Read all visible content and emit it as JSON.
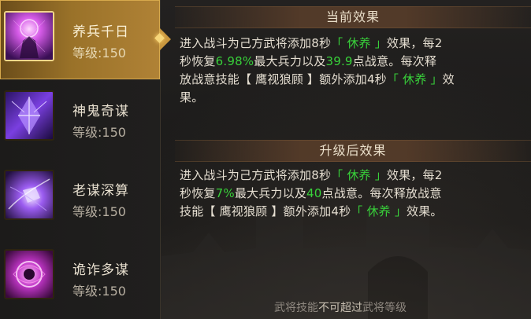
{
  "skills": [
    {
      "name": "养兵千日",
      "level_prefix": "等级:",
      "level": "150",
      "selected": true
    },
    {
      "name": "神鬼奇谋",
      "level_prefix": "等级:",
      "level": "150",
      "selected": false
    },
    {
      "name": "老谋深算",
      "level_prefix": "等级:",
      "level": "150",
      "selected": false
    },
    {
      "name": "诡诈多谋",
      "level_prefix": "等级:",
      "level": "150",
      "selected": false
    }
  ],
  "current_effect": {
    "title": "当前效果",
    "line1": {
      "a": "进入战斗为己方武将添加8秒",
      "b": "「 休养 」",
      "c": "效果，每2"
    },
    "line2": {
      "a": "秒恢复",
      "b": "6.98%",
      "c": "最大兵力以及",
      "d": "39.9",
      "e": "点战意。每次释"
    },
    "line3": {
      "a": "放战意技能【 鹰视狼顾 】额外添加4秒",
      "b": "「 休养 」",
      "c": "效"
    },
    "line4": "果。"
  },
  "upgrade_effect": {
    "title": "升级后效果",
    "line1": {
      "a": "进入战斗为己方武将添加8秒",
      "b": "「 休养 」",
      "c": "效果，每2"
    },
    "line2": {
      "a": "秒恢复",
      "b": "7%",
      "c": "最大兵力以及",
      "d": "40",
      "e": "点战意。每次释放战意"
    },
    "line3": {
      "a": "技能【 鹰视狼顾 】额外添加4秒",
      "b": "「 休养 」",
      "c": "效果。"
    }
  },
  "footer": {
    "a": "武将技能",
    "b": "不可超过",
    "c": "武将等级"
  },
  "colors": {
    "highlight": "#38d13a",
    "selected_bg": "#9a7229",
    "text": "#e5ded1"
  }
}
